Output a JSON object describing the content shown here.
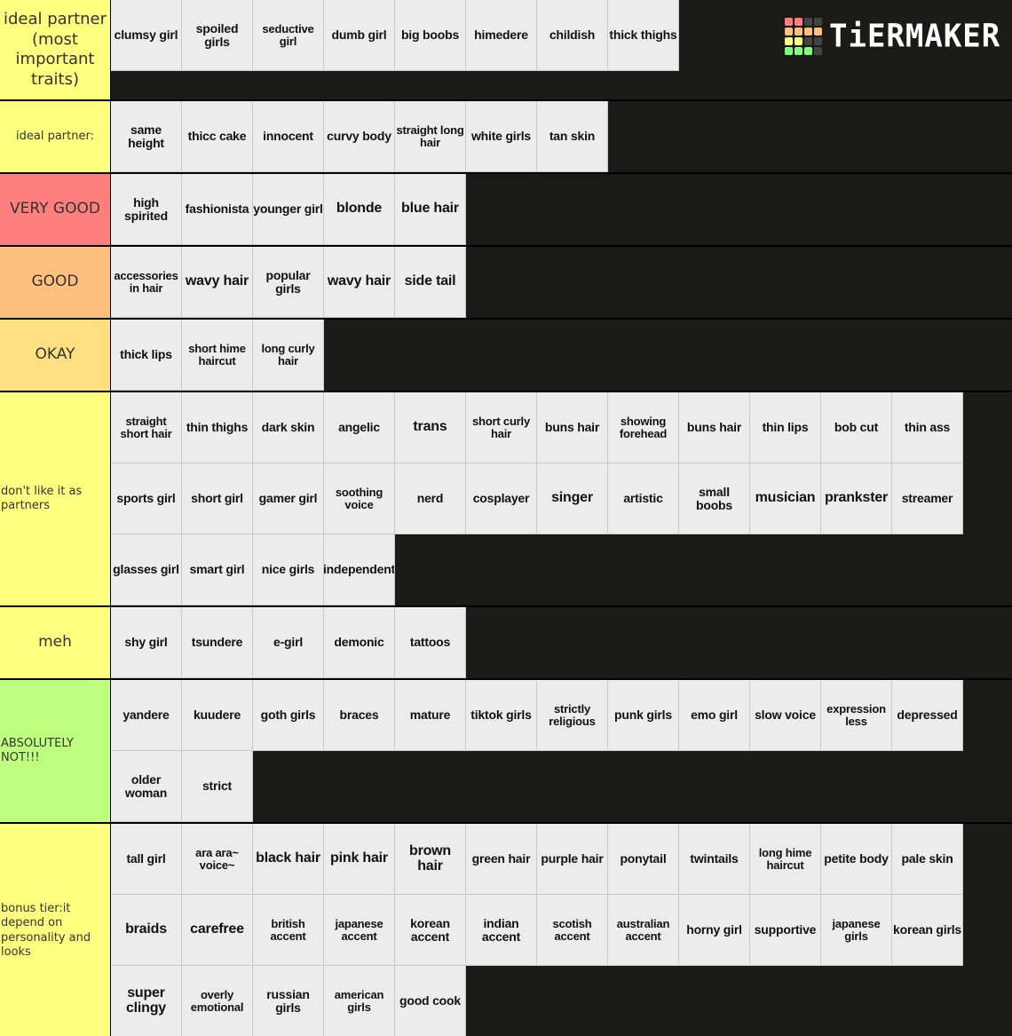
{
  "logo": {
    "text": "TiERMAKER",
    "grid_colors": [
      "#ff7f7f",
      "#ff7f7f",
      "#444444",
      "#444444",
      "#ffbf7f",
      "#ffbf7f",
      "#ffbf7f",
      "#ffbf7f",
      "#ffff7f",
      "#ffff7f",
      "#444444",
      "#444444",
      "#7fff7f",
      "#7fff7f",
      "#7fff7f",
      "#444444"
    ]
  },
  "tiers": [
    {
      "label": "ideal partner (most important traits)",
      "color": "#ffff7f",
      "items": [
        "clumsy girl",
        "spoiled girls",
        "seductive girl",
        "dumb girl",
        "big boobs",
        "himedere",
        "childish",
        "thick thighs"
      ]
    },
    {
      "label": "ideal partner:",
      "color": "#ffff7f",
      "items": [
        "same height",
        "thicc cake",
        "innocent",
        "curvy body",
        "straight long hair",
        "white girls",
        "tan skin"
      ]
    },
    {
      "label": "VERY GOOD",
      "color": "#ff7f7f",
      "items": [
        "high spirited",
        "fashionista",
        "younger girl",
        "blonde",
        "blue hair"
      ]
    },
    {
      "label": "GOOD",
      "color": "#ffbf7f",
      "items": [
        "accessories in hair",
        "wavy hair",
        "popular girls",
        "wavy hair",
        "side tail"
      ]
    },
    {
      "label": "OKAY",
      "color": "#ffdf7f",
      "items": [
        "thick lips",
        "short hime haircut",
        "long curly hair"
      ]
    },
    {
      "label": "don't like it as partners",
      "color": "#ffff7f",
      "items": [
        "straight short hair",
        "thin thighs",
        "dark skin",
        "angelic",
        "trans",
        "short curly hair",
        "buns hair",
        "showing forehead",
        "buns hair",
        "thin lips",
        "bob cut",
        "thin ass",
        "sports girl",
        "short girl",
        "gamer girl",
        "soothing voice",
        "nerd",
        "cosplayer",
        "singer",
        "artistic",
        "small boobs",
        "musician",
        "prankster",
        "streamer",
        "glasses girl",
        "smart girl",
        "nice girls",
        "independent"
      ]
    },
    {
      "label": "meh",
      "color": "#ffff7f",
      "items": [
        "shy girl",
        "tsundere",
        "e-girl",
        "demonic",
        "tattoos"
      ]
    },
    {
      "label": "ABSOLUTELY NOT!!!",
      "color": "#bfff7f",
      "items": [
        "yandere",
        "kuudere",
        "goth girls",
        "braces",
        "mature",
        "tiktok girls",
        "strictly religious",
        "punk girls",
        "emo girl",
        "slow voice",
        "expression less",
        "depressed",
        "older woman",
        "strict"
      ]
    },
    {
      "label": "bonus tier:it depend on personality and looks",
      "color": "#ffff7f",
      "items": [
        "tall girl",
        "ara ara~ voice~",
        "black hair",
        "pink hair",
        "brown hair",
        "green hair",
        "purple hair",
        "ponytail",
        "twintails",
        "long hime haircut",
        "petite body",
        "pale skin",
        "braids",
        "carefree",
        "british accent",
        "japanese accent",
        "korean accent",
        "indian accent",
        "scotish accent",
        "australian accent",
        "horny girl",
        "supportive",
        "japanese girls",
        "korean girls",
        "super clingy",
        "overly emotional",
        "russian girls",
        "american girls",
        "good cook"
      ]
    }
  ]
}
